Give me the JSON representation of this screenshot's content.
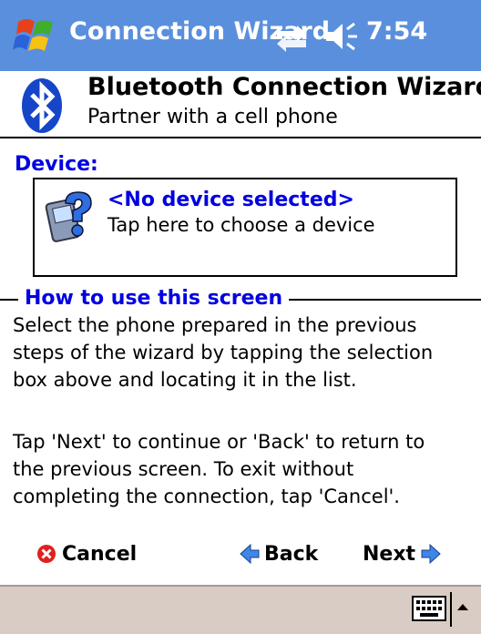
{
  "titlebar": {
    "title": "Connection Wizard",
    "time": "7:54",
    "color": "#5a8fdd",
    "icons": [
      "windows-start-icon",
      "connectivity-icon",
      "speaker-icon"
    ]
  },
  "wizard": {
    "title": "Bluetooth Connection Wizard",
    "subtitle": "Partner with a cell phone"
  },
  "device": {
    "label": "Device:",
    "selected": "<No device selected>",
    "hint": "Tap here to choose a device",
    "label_color": "#0000e0"
  },
  "howto": {
    "label": "How to use this screen",
    "paragraph1_lines": [
      "Select the phone prepared in the previous",
      "steps of the wizard by tapping the selection",
      "box above and locating it in the list."
    ],
    "paragraph2_lines": [
      "Tap 'Next' to continue or 'Back' to return to",
      "the previous screen. To exit without",
      "completing the connection, tap 'Cancel'."
    ]
  },
  "commands": {
    "cancel": "Cancel",
    "back": "Back",
    "next": "Next"
  },
  "menubar": {
    "color": "#d9ccc4",
    "icons": [
      "keyboard-icon",
      "sip-arrow-icon"
    ]
  }
}
